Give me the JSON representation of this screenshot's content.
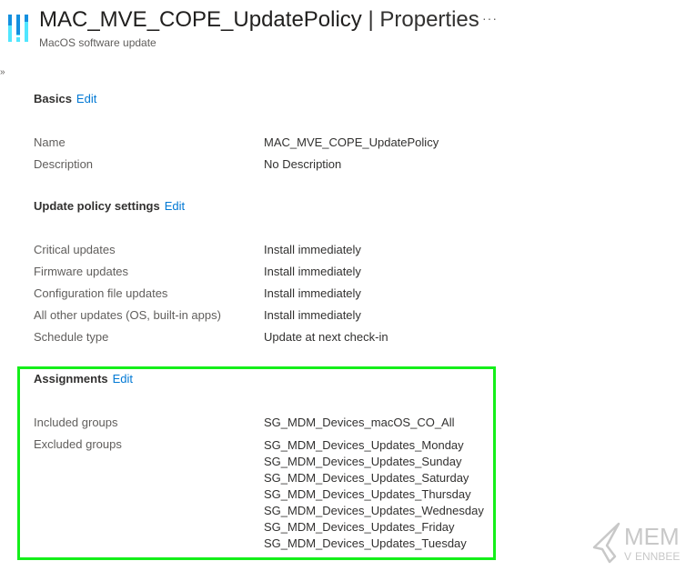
{
  "header": {
    "title": "MAC_MVE_COPE_UpdatePolicy",
    "separator": "|",
    "page": "Properties",
    "subtitle": "MacOS software update",
    "more_label": "···",
    "expand_label": "»"
  },
  "sections": {
    "basics": {
      "title": "Basics",
      "edit_label": "Edit",
      "rows": [
        {
          "label": "Name",
          "value": "MAC_MVE_COPE_UpdatePolicy"
        },
        {
          "label": "Description",
          "value": "No Description"
        }
      ]
    },
    "update_policy": {
      "title": "Update policy settings",
      "edit_label": "Edit",
      "rows": [
        {
          "label": "Critical updates",
          "value": "Install immediately"
        },
        {
          "label": "Firmware updates",
          "value": "Install immediately"
        },
        {
          "label": "Configuration file updates",
          "value": "Install immediately"
        },
        {
          "label": "All other updates (OS, built-in apps)",
          "value": "Install immediately"
        },
        {
          "label": "Schedule type",
          "value": "Update at next check-in"
        }
      ]
    },
    "assignments": {
      "title": "Assignments",
      "edit_label": "Edit",
      "included_label": "Included groups",
      "included_groups": [
        "SG_MDM_Devices_macOS_CO_All"
      ],
      "excluded_label": "Excluded groups",
      "excluded_groups": [
        "SG_MDM_Devices_Updates_Monday",
        "SG_MDM_Devices_Updates_Sunday",
        "SG_MDM_Devices_Updates_Saturday",
        "SG_MDM_Devices_Updates_Thursday",
        "SG_MDM_Devices_Updates_Wednesday",
        "SG_MDM_Devices_Updates_Friday",
        "SG_MDM_Devices_Updates_Tuesday"
      ]
    }
  },
  "watermark": {
    "line1": "MEM",
    "line2": "ENNBEE"
  },
  "colors": {
    "accent": "#0078d4",
    "highlight": "#14ef1a"
  }
}
